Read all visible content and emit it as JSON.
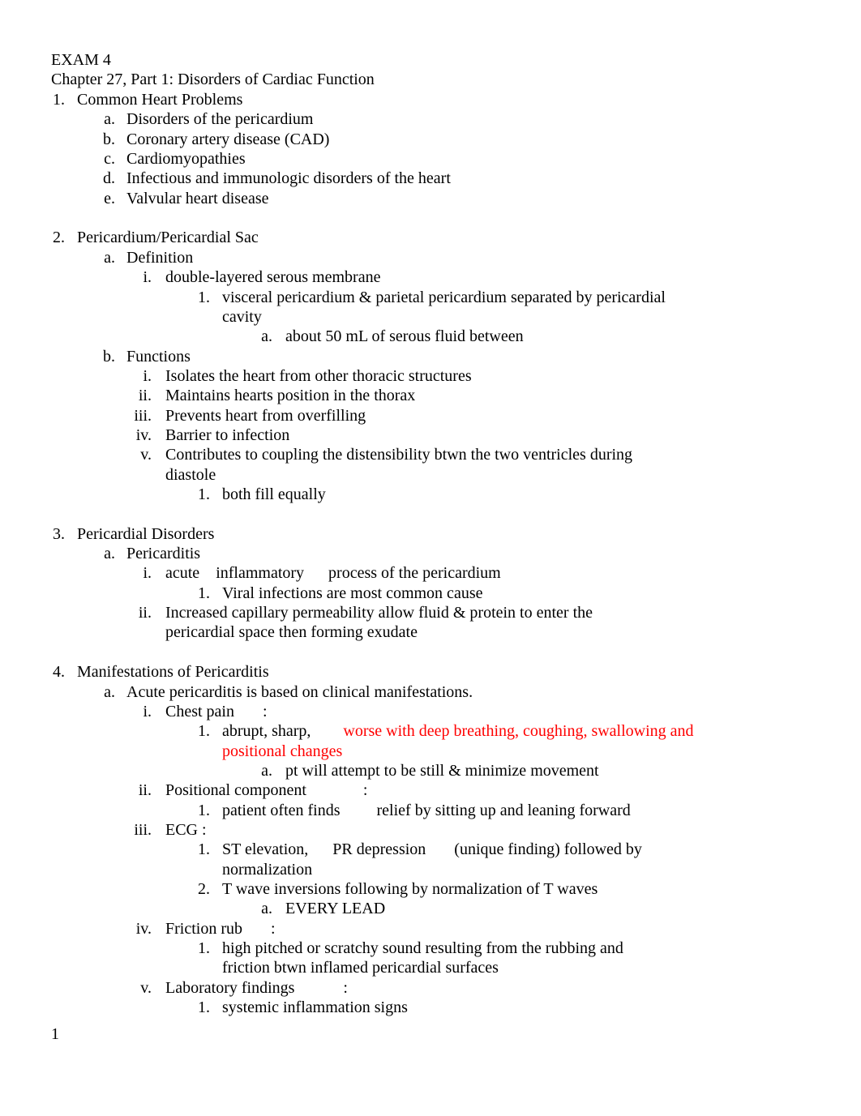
{
  "document": {
    "title": "EXAM 4",
    "subtitle": "Chapter 27, Part 1: Disorders of Cardiac Function",
    "page_number": "1",
    "accent_color": "#ff0000"
  },
  "lines": [
    {
      "marker": "1.",
      "level": 1,
      "text": "Common Heart Problems"
    },
    {
      "marker": "a.",
      "level": 2,
      "text": "Disorders of the pericardium"
    },
    {
      "marker": "b.",
      "level": 2,
      "text": "Coronary artery disease (CAD)"
    },
    {
      "marker": "c.",
      "level": 2,
      "text": "Cardiomyopathies"
    },
    {
      "marker": "d.",
      "level": 2,
      "text": "Infectious and immunologic disorders of the heart"
    },
    {
      "marker": "e.",
      "level": 2,
      "text": "Valvular heart disease"
    },
    {
      "blank": true
    },
    {
      "marker": "2.",
      "level": 1,
      "text": "Pericardium/Pericardial Sac"
    },
    {
      "marker": "a.",
      "level": 2,
      "text": "Definition"
    },
    {
      "marker": "i.",
      "level": 3,
      "text": "double-layered serous membrane"
    },
    {
      "marker": "1.",
      "level": 4,
      "text": "visceral pericardium & parietal pericardium separated by pericardial"
    },
    {
      "marker": "",
      "level": 4,
      "text": "cavity"
    },
    {
      "marker": "a.",
      "level": 5,
      "text": "about 50 mL of serous fluid between"
    },
    {
      "marker": "b.",
      "level": 2,
      "text": "Functions"
    },
    {
      "marker": "i.",
      "level": 3,
      "text": "Isolates the heart from other thoracic structures"
    },
    {
      "marker": "ii.",
      "level": 3,
      "text": "Maintains hearts position in the thorax"
    },
    {
      "marker": "iii.",
      "level": 3,
      "text": "Prevents heart from overfilling"
    },
    {
      "marker": "iv.",
      "level": 3,
      "text": "Barrier to infection"
    },
    {
      "marker": "v.",
      "level": 3,
      "text": "Contributes to coupling the distensibility btwn the two ventricles during"
    },
    {
      "marker": "",
      "level": 3,
      "text": "diastole"
    },
    {
      "marker": "1.",
      "level": 4,
      "text": "both fill equally"
    },
    {
      "blank": true
    },
    {
      "marker": "3.",
      "level": 1,
      "text": "Pericardial Disorders"
    },
    {
      "marker": "a.",
      "level": 2,
      "text": "Pericarditis"
    },
    {
      "marker": "i.",
      "level": 3,
      "text": "acute    inflammatory      process of the pericardium"
    },
    {
      "marker": "1.",
      "level": 4,
      "text": "Viral infections are most common cause"
    },
    {
      "marker": "ii.",
      "level": 3,
      "text": "Increased capillary permeability allow fluid & protein to enter the"
    },
    {
      "marker": "",
      "level": 3,
      "text": "pericardial space then forming exudate"
    },
    {
      "blank": true
    },
    {
      "marker": "4.",
      "level": 1,
      "text": "Manifestations of Pericarditis"
    },
    {
      "marker": "a.",
      "level": 2,
      "text": "Acute pericarditis is based on clinical manifestations."
    },
    {
      "marker": "i.",
      "level": 3,
      "text": "Chest pain       :"
    },
    {
      "marker": "1.",
      "level": 4,
      "text": "abrupt, sharp,        ",
      "red": "worse with deep breathing, coughing, swallowing and"
    },
    {
      "marker": "",
      "level": 4,
      "text": "",
      "red": "positional changes"
    },
    {
      "marker": "a.",
      "level": 5,
      "text": "pt will attempt to be still & minimize movement"
    },
    {
      "marker": "ii.",
      "level": 3,
      "text": "Positional component              :"
    },
    {
      "marker": "1.",
      "level": 4,
      "text": "patient often finds         relief by sitting up and leaning forward"
    },
    {
      "marker": "iii.",
      "level": 3,
      "text": "ECG :"
    },
    {
      "marker": "1.",
      "level": 4,
      "text": "ST elevation,      PR depression       (unique finding) followed by"
    },
    {
      "marker": "",
      "level": 4,
      "text": "normalization"
    },
    {
      "marker": "2.",
      "level": 4,
      "text": "T wave inversions following by normalization of T waves"
    },
    {
      "marker": "a.",
      "level": 5,
      "text": "EVERY LEAD"
    },
    {
      "marker": "iv.",
      "level": 3,
      "text": "Friction rub       :"
    },
    {
      "marker": "1.",
      "level": 4,
      "text": "high pitched or scratchy sound resulting from the rubbing and"
    },
    {
      "marker": "",
      "level": 4,
      "text": "friction btwn inflamed pericardial surfaces"
    },
    {
      "marker": "v.",
      "level": 3,
      "text": "Laboratory findings            :"
    },
    {
      "marker": "1.",
      "level": 4,
      "text": "systemic inflammation signs"
    }
  ]
}
